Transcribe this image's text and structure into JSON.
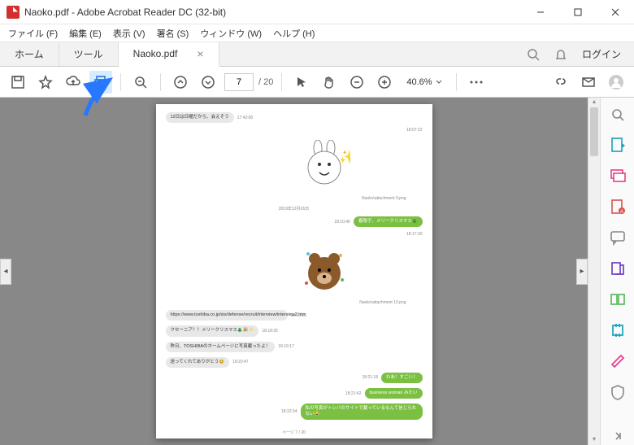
{
  "window": {
    "title": "Naoko.pdf - Adobe Acrobat Reader DC (32-bit)"
  },
  "menu": {
    "file": "ファイル (F)",
    "edit": "編集 (E)",
    "view": "表示 (V)",
    "sign": "署名 (S)",
    "window": "ウィンドウ (W)",
    "help": "ヘルプ (H)"
  },
  "tabs": {
    "home": "ホーム",
    "tools": "ツール",
    "doc": "Naoko.pdf",
    "login": "ログイン"
  },
  "toolbar": {
    "page_current": "7",
    "page_sep": "/ 20",
    "zoom": "40.6%"
  },
  "chat": {
    "msg1": "12日は日曜だから、会えそう",
    "t1": "17:43:08",
    "t2": "18:07:22",
    "sticker1_label": "Naoko\\attachment 9.png",
    "date": "2019年12月26日",
    "msg2": "春陽子、メリークリスマス🎄",
    "t3": "18:10:40",
    "t4": "18:17:30",
    "sticker2_label": "Naoko\\attachment 10.png",
    "msg3": "https://www.toshiba.co.jp/sis/defense/recruit/interview/interview2.htm",
    "t5": "18:18:01",
    "msg4": "クセーニア！！メリークリスマス🎄🎉✨",
    "t6": "18:18:35",
    "msg5": "昨日、TOSHIBAのホームページに写真載ったよ！",
    "t7": "18:19:17",
    "msg6": "送ってくれてありがとう😊",
    "t8": "18:20:47",
    "msg7": "わあ！すごい！",
    "t9": "18:21:18",
    "msg8": "business woman みたい",
    "t10": "18:21:42",
    "msg9": "私の写真がトシバのサイトで載っているなんて信じられない😭",
    "t11": "18:22:34",
    "page_num": "ページ 7 / 20"
  }
}
